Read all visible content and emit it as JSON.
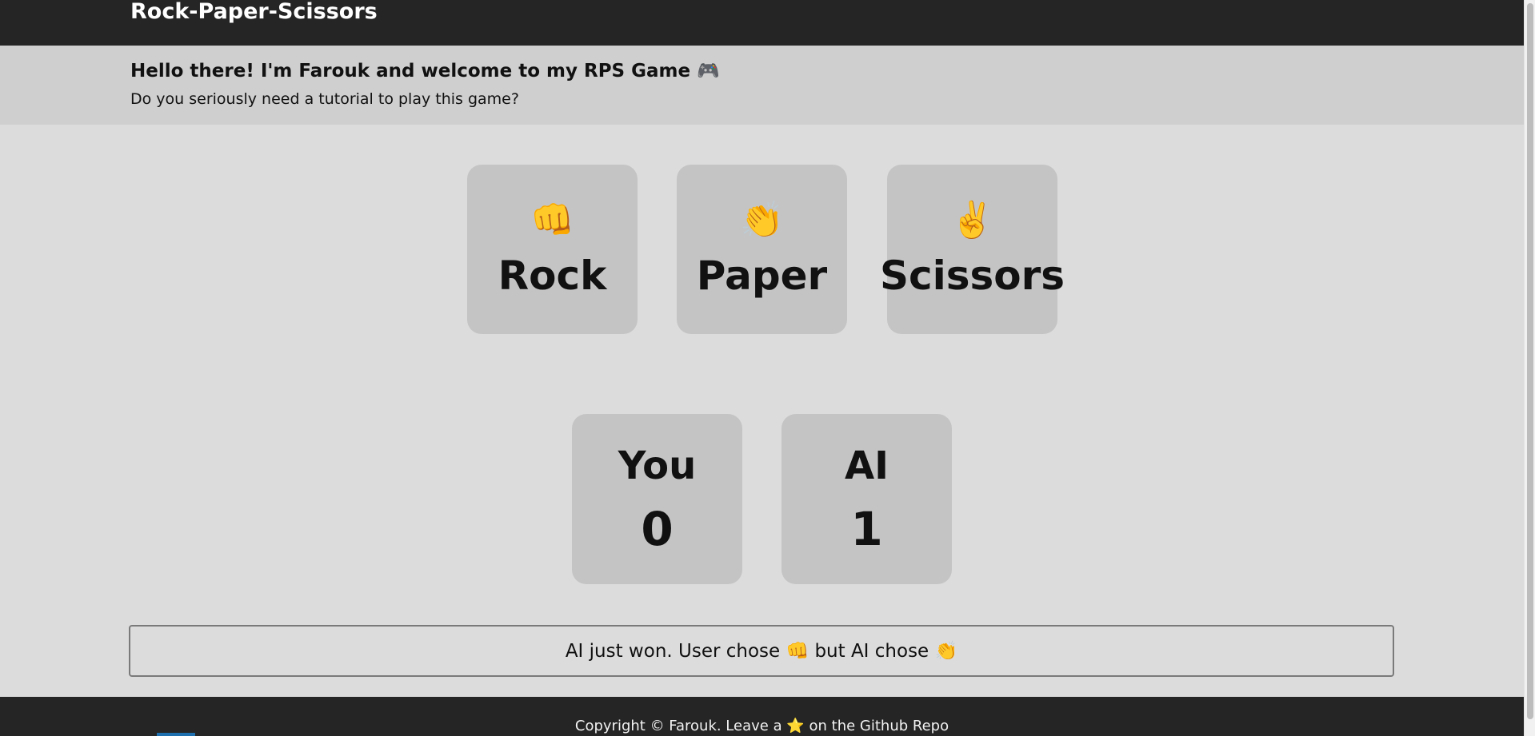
{
  "header": {
    "title": "Rock-Paper-Scissors"
  },
  "intro": {
    "title": "Hello there! I'm Farouk and welcome to my RPS Game 🎮",
    "subtitle": "Do you seriously need a tutorial to play this game?"
  },
  "choices": [
    {
      "emoji": "👊",
      "label": "Rock",
      "icon": "rock-fist-icon"
    },
    {
      "emoji": "👏",
      "label": "Paper",
      "icon": "paper-clapping-hands-icon"
    },
    {
      "emoji": "✌️",
      "label": "Scissors",
      "icon": "scissors-victory-hand-icon"
    }
  ],
  "scores": {
    "user": {
      "label": "You",
      "value": "0"
    },
    "ai": {
      "label": "AI",
      "value": "1"
    }
  },
  "result": {
    "text": "AI just won. User chose 👊 but AI chose 👏"
  },
  "footer": {
    "text_before_star": "Copyright © Farouk. Leave a",
    "star": "⭐",
    "text_after_star": "on the Github Repo"
  },
  "colors": {
    "header_bg": "#252525",
    "intro_bg": "#cfcfcf",
    "page_bg": "#dcdcdc",
    "card_bg": "#c4c4c4",
    "footer_bg": "#252525"
  }
}
